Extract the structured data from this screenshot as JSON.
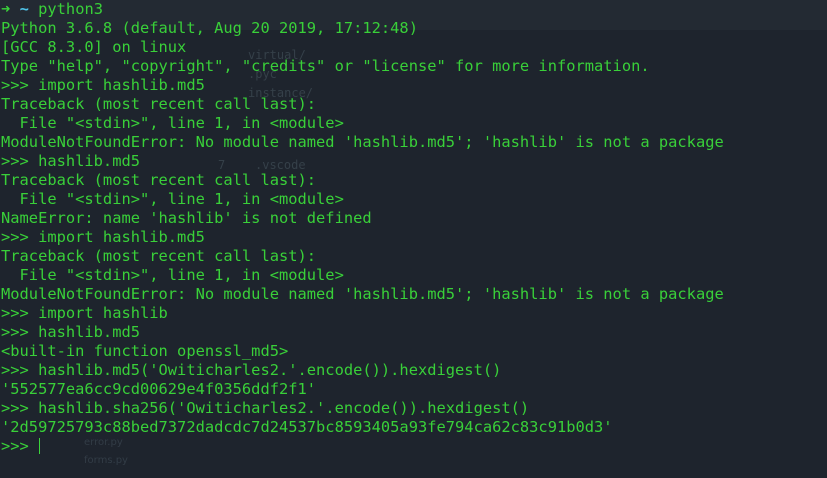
{
  "colors": {
    "background": "#1e242d",
    "text": "#39d039",
    "prompt_arrow": "#3bd43b",
    "prompt_tilde": "#4fc3e8"
  },
  "shell_prompt": {
    "arrow": "➜",
    "cwd": "~",
    "command": "python3"
  },
  "output_lines": [
    "Python 3.6.8 (default, Aug 20 2019, 17:12:48)",
    "[GCC 8.3.0] on linux",
    "Type \"help\", \"copyright\", \"credits\" or \"license\" for more information.",
    ">>> import hashlib.md5",
    "Traceback (most recent call last):",
    "  File \"<stdin>\", line 1, in <module>",
    "ModuleNotFoundError: No module named 'hashlib.md5'; 'hashlib' is not a package",
    ">>> hashlib.md5",
    "Traceback (most recent call last):",
    "  File \"<stdin>\", line 1, in <module>",
    "NameError: name 'hashlib' is not defined",
    ">>> import hashlib.md5",
    "Traceback (most recent call last):",
    "  File \"<stdin>\", line 1, in <module>",
    "ModuleNotFoundError: No module named 'hashlib.md5'; 'hashlib' is not a package",
    ">>> import hashlib",
    ">>> hashlib.md5",
    "<built-in function openssl_md5>",
    ">>> hashlib.md5('Owiticharles2.'.encode()).hexdigest()",
    "'552577ea6cc9cd00629e4f0356ddf2f1'",
    ">>> hashlib.sha256('Owiticharles2.'.encode()).hexdigest()",
    "'2d59725793c88bed7372dadcdc7d24537bc8593405a93fe794ca62c83c91b0d3'"
  ],
  "input_prompt": ">>> ",
  "ghost": {
    "files": [
      "virtual/",
      ".pyc",
      "instance/",
      ".vscode",
      "error.py",
      "forms.py"
    ],
    "line_number": "7"
  }
}
